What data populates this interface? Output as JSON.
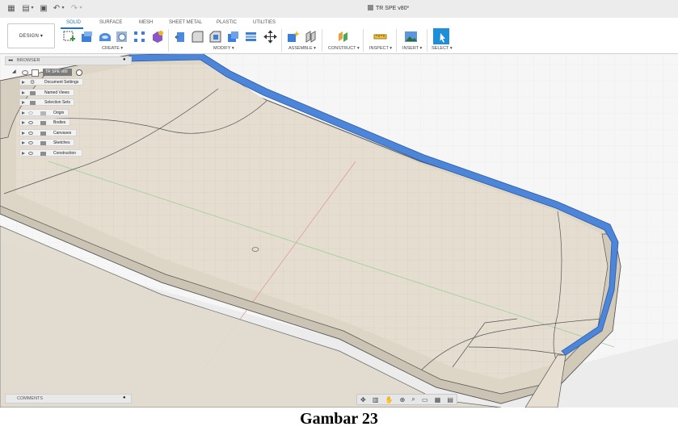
{
  "window": {
    "title": "TR SPE v80*"
  },
  "workspace": {
    "switcher_label": "DESIGN ▾"
  },
  "ribbon": {
    "tabs": [
      {
        "label": "SOLID"
      },
      {
        "label": "SURFACE"
      },
      {
        "label": "MESH"
      },
      {
        "label": "SHEET METAL"
      },
      {
        "label": "PLASTIC"
      },
      {
        "label": "UTILITIES"
      }
    ],
    "groups": [
      {
        "label": "CREATE ▾"
      },
      {
        "label": "MODIFY ▾"
      },
      {
        "label": "ASSEMBLE ▾"
      },
      {
        "label": "CONSTRUCT ▾"
      },
      {
        "label": "INSPECT ▾"
      },
      {
        "label": "INSERT ▾"
      },
      {
        "label": "SELECT ▾"
      }
    ]
  },
  "browser": {
    "title": "BROWSER",
    "root_label": "TR SPE v80",
    "items": [
      {
        "label": "Document Settings"
      },
      {
        "label": "Named Views"
      },
      {
        "label": "Selection Sets"
      },
      {
        "label": "Origin"
      },
      {
        "label": "Bodies"
      },
      {
        "label": "Canvases"
      },
      {
        "label": "Sketches"
      },
      {
        "label": "Construction"
      }
    ]
  },
  "comments": {
    "title": "COMMENTS"
  },
  "caption": "Gambar 23",
  "colors": {
    "accent": "#1e73be",
    "model_body": "#e4ddd0",
    "model_edge_highlight": "#4d86d9",
    "viewport_bg": "#f6f6f6"
  }
}
